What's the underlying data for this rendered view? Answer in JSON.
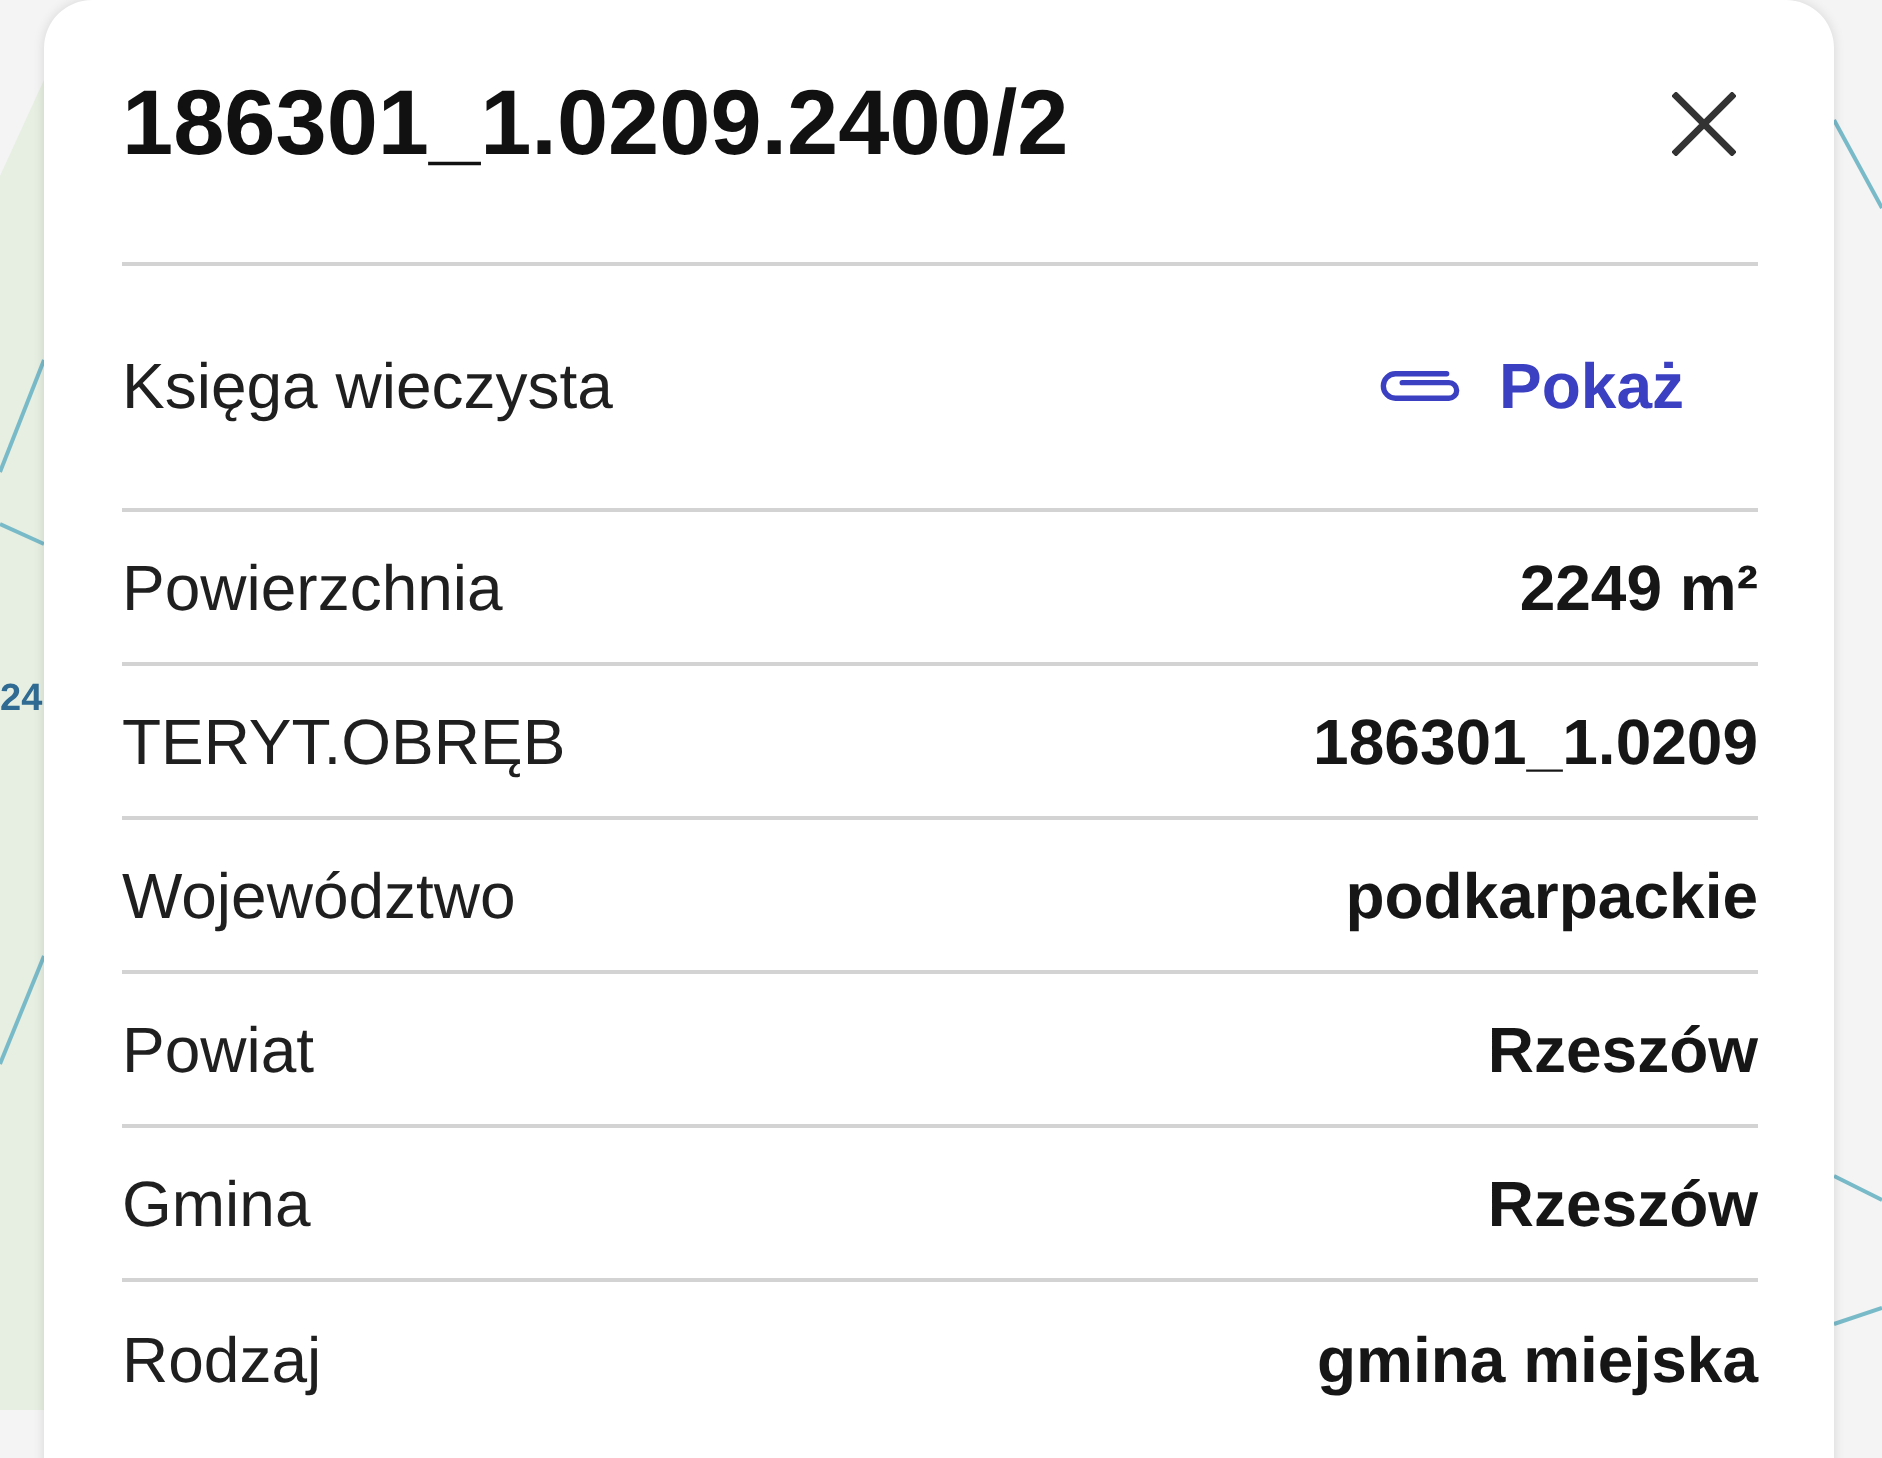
{
  "map": {
    "labels": [
      "24"
    ]
  },
  "panel": {
    "title": "186301_1.0209.2400/2",
    "land_register": {
      "label": "Księga wieczysta",
      "link": "Pokaż"
    },
    "attributes": [
      {
        "label": "Powierzchnia",
        "value": "2249 m²"
      },
      {
        "label": "TERYT.OBRĘB",
        "value": "186301_1.0209"
      },
      {
        "label": "Województwo",
        "value": "podkarpackie"
      },
      {
        "label": "Powiat",
        "value": "Rzeszów"
      },
      {
        "label": "Gmina",
        "value": "Rzeszów"
      },
      {
        "label": "Rodzaj",
        "value": "gmina miejska"
      }
    ]
  }
}
